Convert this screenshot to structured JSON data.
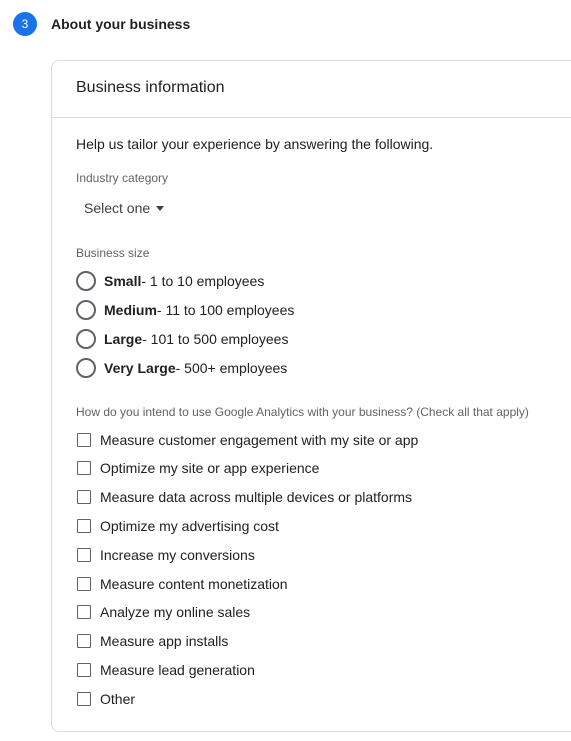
{
  "step": {
    "number": "3",
    "title": "About your business"
  },
  "card": {
    "title": "Business information",
    "intro": "Help us tailor your experience by answering the following."
  },
  "industry": {
    "label": "Industry category",
    "selected": "Select one"
  },
  "business_size": {
    "label": "Business size",
    "options": [
      {
        "name": "Small",
        "detail": " - 1 to 10 employees"
      },
      {
        "name": "Medium",
        "detail": " - 11 to 100 employees"
      },
      {
        "name": "Large",
        "detail": " - 101 to 500 employees"
      },
      {
        "name": "Very Large",
        "detail": " - 500+ employees"
      }
    ]
  },
  "usage": {
    "question": "How do you intend to use Google Analytics with your business? (Check all that apply)",
    "options": [
      "Measure customer engagement with my site or app",
      "Optimize my site or app experience",
      "Measure data across multiple devices or platforms",
      "Optimize my advertising cost",
      "Increase my conversions",
      "Measure content monetization",
      "Analyze my online sales",
      "Measure app installs",
      "Measure lead generation",
      "Other"
    ]
  },
  "colors": {
    "accent": "#1a73e8",
    "border": "#dadce0",
    "text": "#202124",
    "secondary_text": "#5f6368"
  }
}
